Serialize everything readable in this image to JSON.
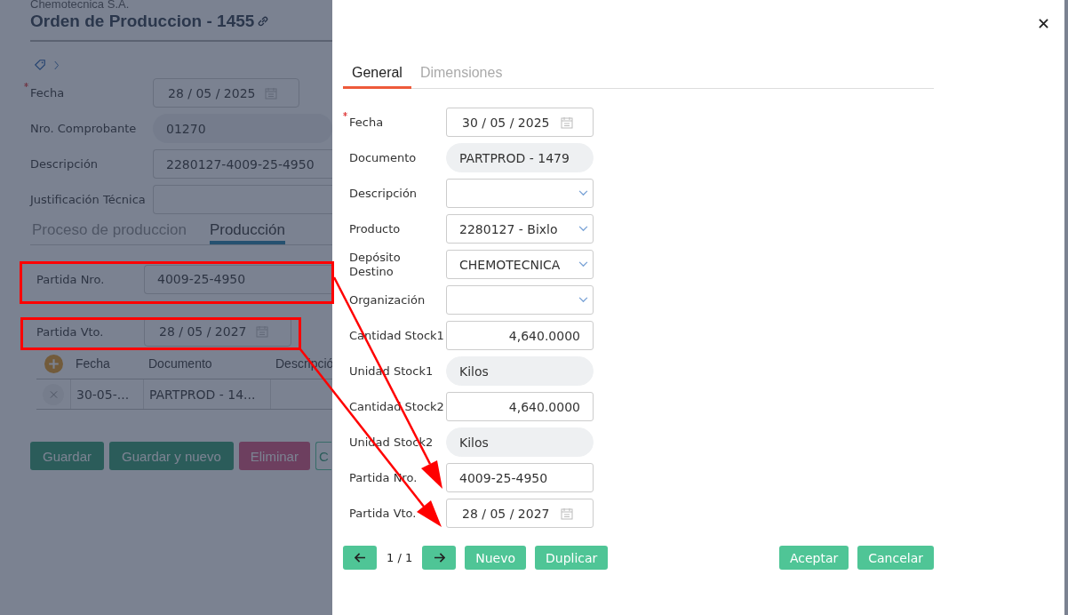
{
  "page": {
    "company": "Chemotecnica S.A.",
    "title": "Orden de Produccion - 1455",
    "fields": [
      {
        "kind": "date",
        "label": "Fecha",
        "required": true,
        "value": "28 / 05 / 2025"
      },
      {
        "kind": "readonly",
        "label": "Nro. Comprobante",
        "required": false,
        "value": "01270"
      },
      {
        "kind": "text",
        "label": "Descripción",
        "required": false,
        "value": "2280127-4009-25-4950"
      },
      {
        "kind": "text",
        "label": "Justificación Técnica",
        "required": false
      }
    ],
    "tabs": [
      {
        "label": "Proceso de produccion",
        "selected": false
      },
      {
        "label": "Producción",
        "selected": true
      }
    ],
    "partida": [
      {
        "kind": "text",
        "label": "Partida Nro.",
        "value": "4009-25-4950"
      },
      {
        "kind": "date",
        "label": "Partida Vto.",
        "value": "28 / 05 / 2027"
      }
    ],
    "table": {
      "columns": [
        "Fecha",
        "Documento",
        "Descripció"
      ],
      "rows": [
        [
          "30-05-...",
          "PARTPROD - 14..."
        ]
      ]
    },
    "buttons": [
      {
        "label": "Guardar",
        "kind": "primary"
      },
      {
        "label": "Guardar y nuevo",
        "kind": "primary"
      },
      {
        "label": "Eliminar",
        "kind": "danger"
      },
      {
        "label": "C",
        "kind": "outline"
      }
    ]
  },
  "modal": {
    "tabs": [
      {
        "label": "General",
        "selected": true
      },
      {
        "label": "Dimensiones",
        "selected": false
      }
    ],
    "fields": [
      {
        "kind": "date",
        "label": "Fecha",
        "required": true,
        "value": "30 / 05 / 2025"
      },
      {
        "kind": "readonly",
        "label": "Documento",
        "required": false,
        "value": "PARTPROD - 1479"
      },
      {
        "kind": "select",
        "label": "Descripción",
        "required": false
      },
      {
        "kind": "select",
        "label": "Producto",
        "required": false,
        "value": "2280127 - Bixlo"
      },
      {
        "kind": "select",
        "label": "Depósito Destino",
        "required": false,
        "value": "CHEMOTECNICA"
      },
      {
        "kind": "select",
        "label": "Organización",
        "required": false
      },
      {
        "kind": "number",
        "label": "Cantidad Stock1",
        "required": false,
        "value": "4,640.0000"
      },
      {
        "kind": "readonly",
        "label": "Unidad Stock1",
        "required": false,
        "value": "Kilos"
      },
      {
        "kind": "number",
        "label": "Cantidad Stock2",
        "required": false,
        "value": "4,640.0000"
      },
      {
        "kind": "readonly",
        "label": "Unidad Stock2",
        "required": false,
        "value": "Kilos"
      },
      {
        "kind": "text",
        "label": "Partida Nro.",
        "required": false,
        "value": "4009-25-4950"
      },
      {
        "kind": "date",
        "label": "Partida Vto.",
        "required": false,
        "value": "28 / 05 / 2027"
      }
    ],
    "pager": "1 / 1",
    "left_buttons": [
      "Nuevo",
      "Duplicar"
    ],
    "right_buttons": [
      "Aceptar",
      "Cancelar"
    ]
  }
}
